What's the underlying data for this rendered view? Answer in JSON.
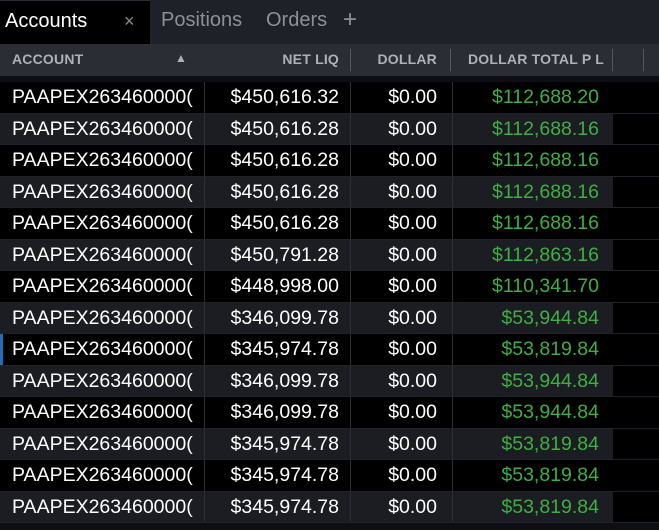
{
  "tabs": {
    "active": "Accounts",
    "others": [
      "Positions",
      "Orders"
    ],
    "close_glyph": "×",
    "add_glyph": "+"
  },
  "columns": {
    "account": "ACCOUNT",
    "net_liq": "NET LIQ",
    "dollar": "DOLLAR",
    "dollar_total_pl": "DOLLAR TOTAL P L",
    "sort_icon": "▲"
  },
  "colors": {
    "positive": "#3fae44",
    "selection_accent": "#1e6fb8"
  },
  "rows": [
    {
      "account": "PAAPEX263460000(",
      "net_liq": "$450,616.32",
      "dollar": "$0.00",
      "pl": "$112,688.20"
    },
    {
      "account": "PAAPEX263460000(",
      "net_liq": "$450,616.28",
      "dollar": "$0.00",
      "pl": "$112,688.16"
    },
    {
      "account": "PAAPEX263460000(",
      "net_liq": "$450,616.28",
      "dollar": "$0.00",
      "pl": "$112,688.16"
    },
    {
      "account": "PAAPEX263460000(",
      "net_liq": "$450,616.28",
      "dollar": "$0.00",
      "pl": "$112,688.16"
    },
    {
      "account": "PAAPEX263460000(",
      "net_liq": "$450,616.28",
      "dollar": "$0.00",
      "pl": "$112,688.16"
    },
    {
      "account": "PAAPEX263460000(",
      "net_liq": "$450,791.28",
      "dollar": "$0.00",
      "pl": "$112,863.16"
    },
    {
      "account": "PAAPEX263460000(",
      "net_liq": "$448,998.00",
      "dollar": "$0.00",
      "pl": "$110,341.70"
    },
    {
      "account": "PAAPEX263460000(",
      "net_liq": "$346,099.78",
      "dollar": "$0.00",
      "pl": "$53,944.84"
    },
    {
      "account": "PAAPEX263460000(",
      "net_liq": "$345,974.78",
      "dollar": "$0.00",
      "pl": "$53,819.84",
      "selected": true
    },
    {
      "account": "PAAPEX263460000(",
      "net_liq": "$346,099.78",
      "dollar": "$0.00",
      "pl": "$53,944.84"
    },
    {
      "account": "PAAPEX263460000(",
      "net_liq": "$346,099.78",
      "dollar": "$0.00",
      "pl": "$53,944.84"
    },
    {
      "account": "PAAPEX263460000(",
      "net_liq": "$345,974.78",
      "dollar": "$0.00",
      "pl": "$53,819.84"
    },
    {
      "account": "PAAPEX263460000(",
      "net_liq": "$345,974.78",
      "dollar": "$0.00",
      "pl": "$53,819.84"
    },
    {
      "account": "PAAPEX263460000(",
      "net_liq": "$345,974.78",
      "dollar": "$0.00",
      "pl": "$53,819.84"
    }
  ]
}
